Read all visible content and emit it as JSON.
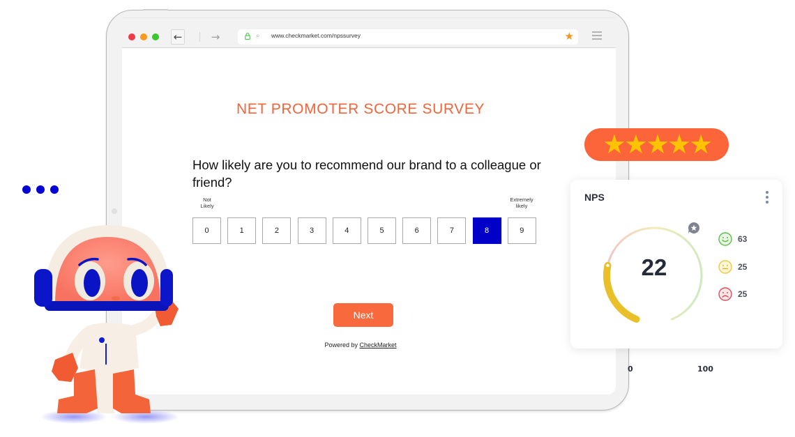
{
  "browser": {
    "url": "www.checkmarket.com/npssurvey",
    "icons": {
      "back": "arrow-left-icon",
      "forward": "arrow-right-icon",
      "lock": "lock-icon",
      "search": "search-icon",
      "bookmark": "star-icon",
      "menu": "hamburger-icon"
    },
    "back_glyph": "←",
    "forward_glyph": "→",
    "search_glyph": "⌕",
    "bookmark_glyph": "★"
  },
  "survey": {
    "title": "NET PROMOTER SCORE SURVEY",
    "question": "How likely are you to recommend our brand to a colleague or friend?",
    "low_label": "Not Likely",
    "high_label": "Extremely likely",
    "scale": [
      "0",
      "1",
      "2",
      "3",
      "4",
      "5",
      "6",
      "7",
      "8",
      "9"
    ],
    "selected": "8",
    "next_label": "Next",
    "powered_prefix": "Powered by ",
    "powered_link": "CheckMarket"
  },
  "rating": {
    "stars": "★★★★★",
    "count": 5
  },
  "nps_card": {
    "title": "NPS",
    "score": "22",
    "range_min": "0",
    "range_max": "100",
    "gauge_fill_fraction": 0.22,
    "breakdown": [
      {
        "type": "promoters",
        "icon": "smile-icon",
        "value": "63",
        "color": "#5cbf4a"
      },
      {
        "type": "passives",
        "icon": "neutral-face-icon",
        "value": "25",
        "color": "#f0c93a"
      },
      {
        "type": "detractors",
        "icon": "frown-icon",
        "value": "25",
        "color": "#d8515a"
      }
    ]
  },
  "colors": {
    "accent_orange": "#f86a3e",
    "selected_blue": "#0000c8",
    "star_yellow": "#fdc300",
    "gauge_yellow": "#e9c02a"
  }
}
